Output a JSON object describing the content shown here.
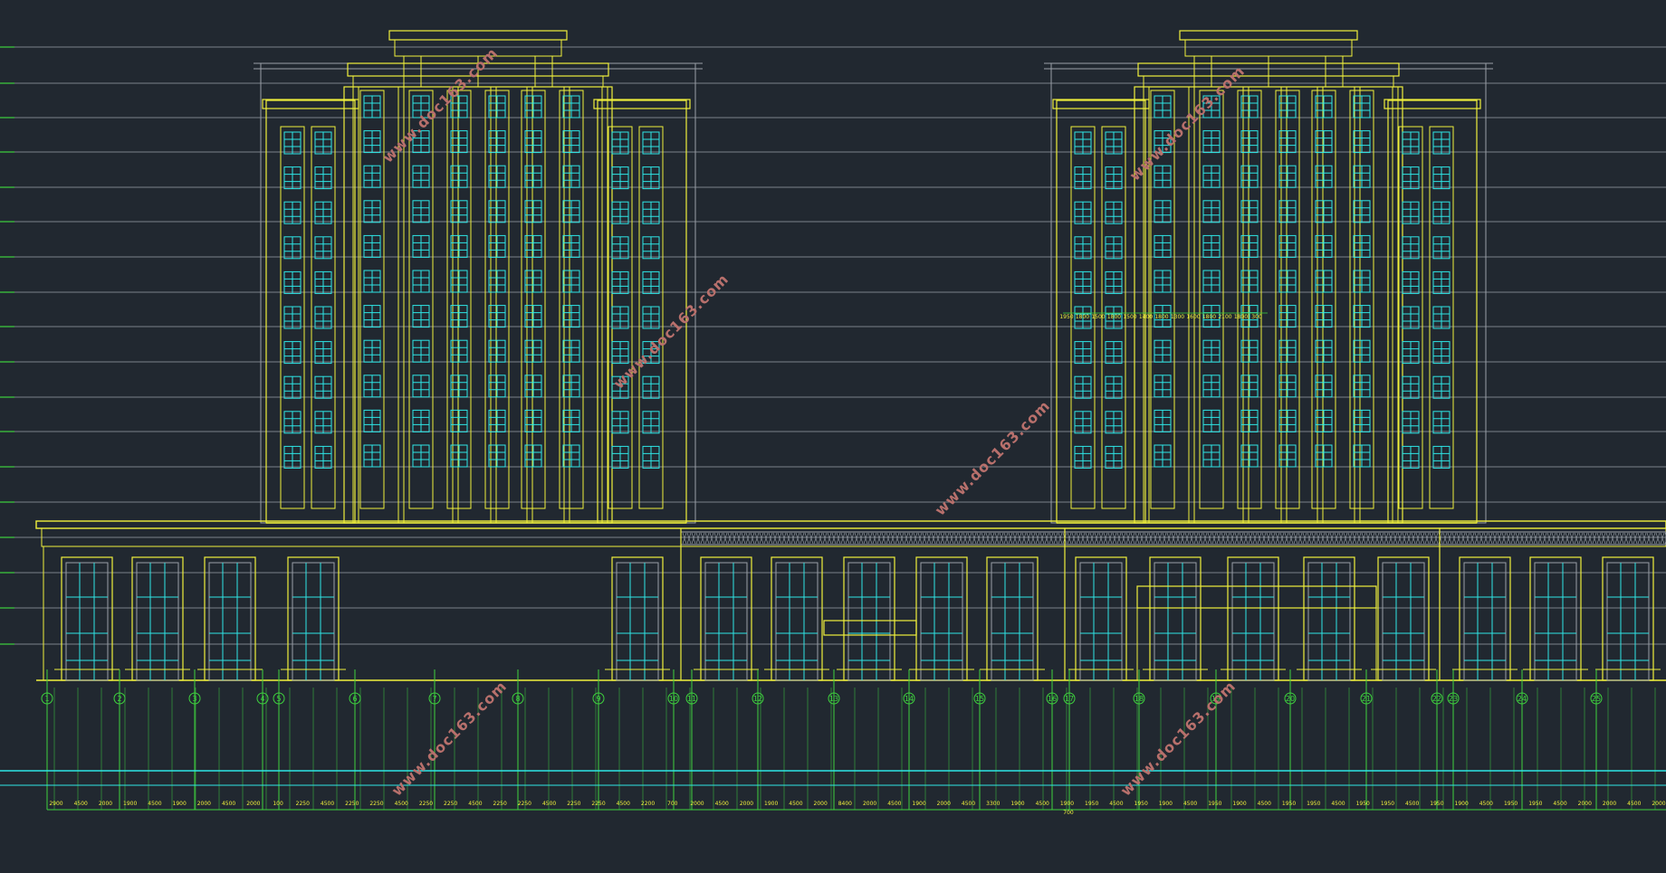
{
  "drawing": {
    "type": "architectural-elevation",
    "watermarks": [
      "www.doc163.com",
      "www.doc163.com",
      "www.doc163.com",
      "www.doc163.com",
      "www.doc163.com",
      "www.doc163.com",
      "www.doc163.com"
    ],
    "axis_labels": [
      "1",
      "2",
      "3",
      "4",
      "5",
      "6",
      "7",
      "8",
      "9",
      "10",
      "11",
      "12",
      "13",
      "14",
      "15",
      "16",
      "17",
      "18",
      "19",
      "20",
      "21",
      "22",
      "23",
      "24",
      "25"
    ],
    "bottom_dims": [
      "2900",
      "4500",
      "2000",
      "1900",
      "4500",
      "1900",
      "2000",
      "4500",
      "2000",
      "100",
      "2250",
      "4500",
      "2250",
      "2250",
      "4500",
      "2250",
      "2250",
      "4500",
      "2250",
      "2250",
      "4500",
      "2250",
      "2250",
      "4500",
      "2200",
      "700",
      "2000",
      "4500",
      "2000",
      "1900",
      "4500",
      "2000",
      "8400",
      "2000",
      "4500",
      "1900",
      "2000",
      "4500",
      "3300",
      "1900",
      "4500",
      "1900",
      "1950",
      "4500",
      "1950",
      "1900",
      "4500",
      "1950",
      "1900",
      "4500",
      "1950",
      "1950",
      "4500",
      "1950",
      "1950",
      "4500",
      "1950",
      "1900",
      "4500",
      "1950",
      "1950",
      "4500",
      "2000",
      "2000",
      "4500",
      "2000"
    ],
    "center_dim": "700",
    "right_tower_dims": [
      "1950",
      "1800",
      "1500",
      "1800",
      "1500",
      "1400",
      "1800",
      "1300",
      "1600",
      "1800",
      "2100",
      "1800",
      "300"
    ],
    "colors": {
      "background": "#212830",
      "outline": "#f0f03c",
      "glazing": "#2ee6e6",
      "grid": "#9aa0a8",
      "axis": "#3ed23e",
      "dim_text": "#f0f03c",
      "watermark": "#b8706c"
    }
  }
}
